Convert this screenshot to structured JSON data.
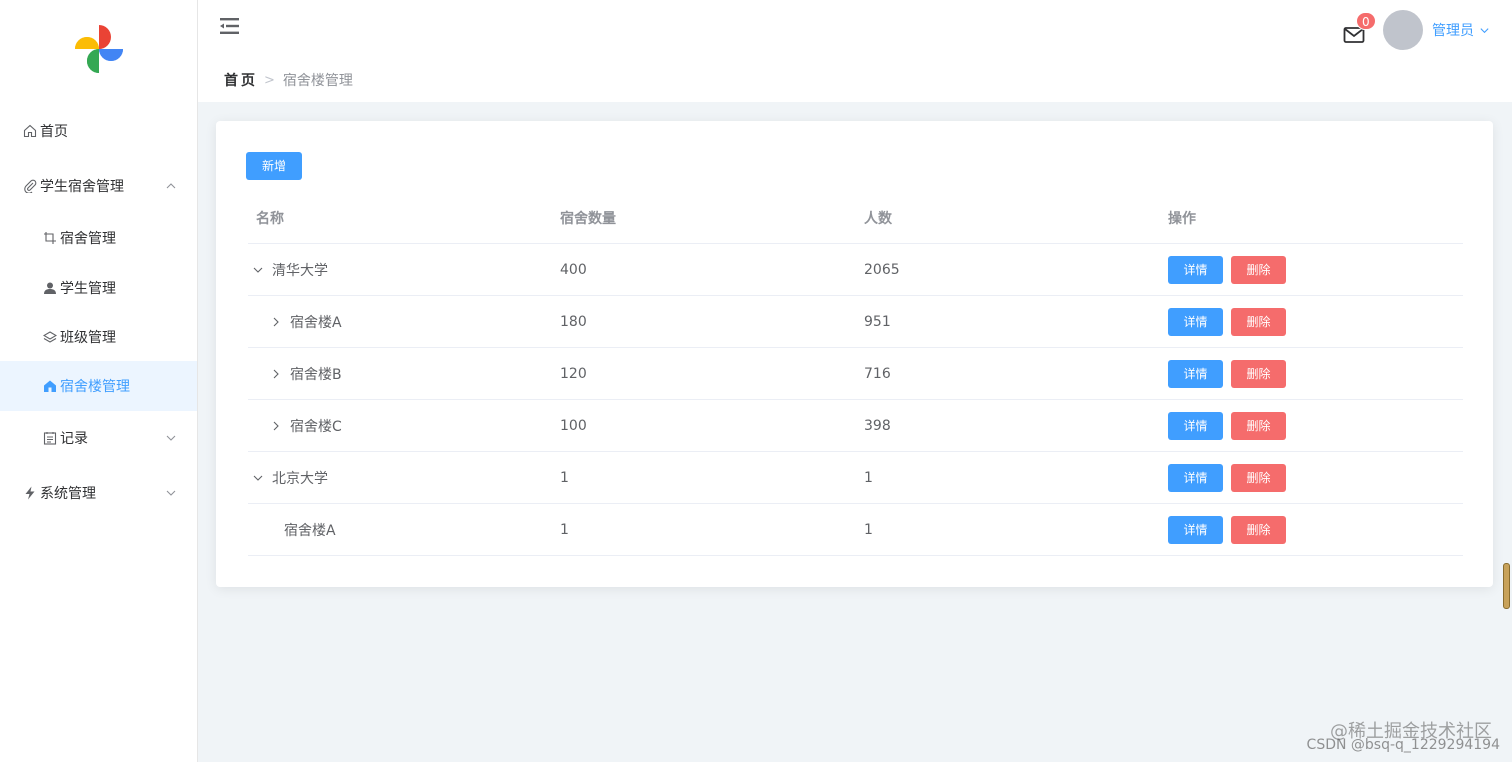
{
  "sidebar": {
    "items": [
      {
        "label": "首页",
        "icon": "home-icon"
      },
      {
        "label": "学生宿舍管理",
        "icon": "paperclip-icon"
      },
      {
        "label": "宿舍管理",
        "icon": "crop-icon"
      },
      {
        "label": "学生管理",
        "icon": "user-icon"
      },
      {
        "label": "班级管理",
        "icon": "layers-icon"
      },
      {
        "label": "宿舍楼管理",
        "icon": "house-icon"
      },
      {
        "label": "记录",
        "icon": "calendar-icon"
      },
      {
        "label": "系统管理",
        "icon": "lightning-icon"
      }
    ]
  },
  "header": {
    "breadcrumb_home": "首页",
    "breadcrumb_sep": ">",
    "breadcrumb_current": "宿舍楼管理",
    "mail_badge": "0",
    "username": "管理员"
  },
  "toolbar": {
    "add_label": "新增"
  },
  "table": {
    "columns": [
      "名称",
      "宿舍数量",
      "人数",
      "操作"
    ],
    "rows": [
      {
        "name": "清华大学",
        "rooms": "400",
        "people": "2065"
      },
      {
        "name": "宿舍楼A",
        "rooms": "180",
        "people": "951"
      },
      {
        "name": "宿舍楼B",
        "rooms": "120",
        "people": "716"
      },
      {
        "name": "宿舍楼C",
        "rooms": "100",
        "people": "398"
      },
      {
        "name": "北京大学",
        "rooms": "1",
        "people": "1"
      },
      {
        "name": "宿舍楼A",
        "rooms": "1",
        "people": "1"
      }
    ],
    "detail_label": "详情",
    "delete_label": "删除"
  },
  "watermark": {
    "line1": "@稀土掘金技术社区",
    "line2": "CSDN @bsq-q_1229294194"
  },
  "colors": {
    "primary": "#409eff",
    "danger": "#f56c6c",
    "active_bg": "#ecf5ff"
  }
}
